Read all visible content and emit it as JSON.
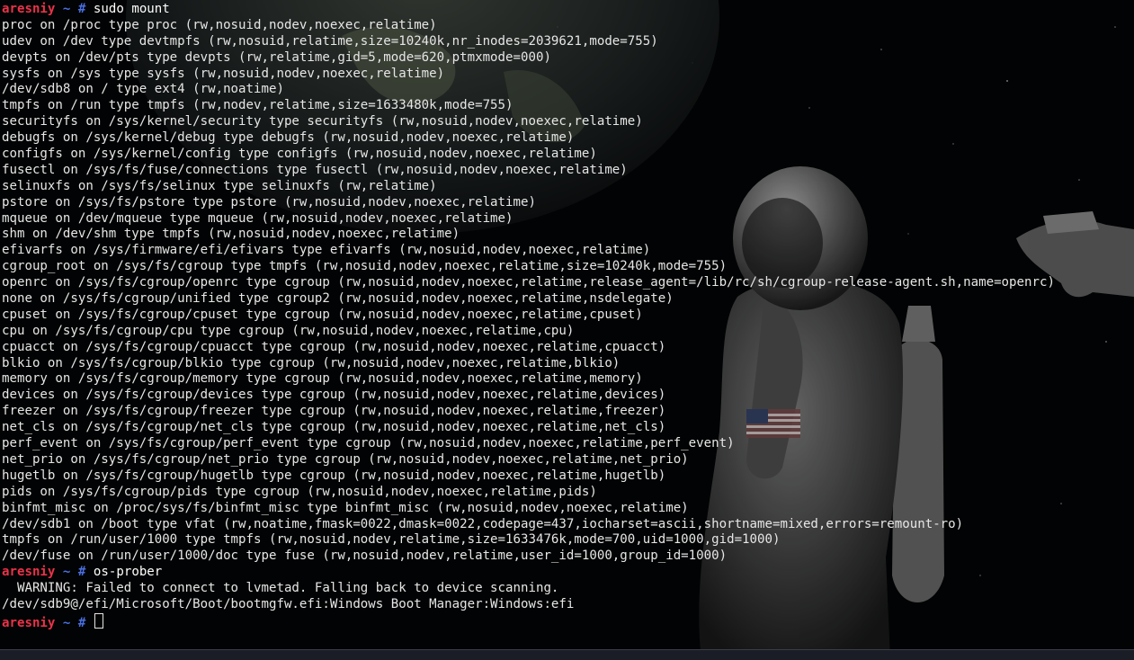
{
  "prompt": {
    "user": "aresniy",
    "dir": "~",
    "symbol": "#"
  },
  "session": [
    {
      "type": "prompt",
      "command": "sudo mount"
    },
    {
      "type": "output",
      "text": "proc on /proc type proc (rw,nosuid,nodev,noexec,relatime)"
    },
    {
      "type": "output",
      "text": "udev on /dev type devtmpfs (rw,nosuid,relatime,size=10240k,nr_inodes=2039621,mode=755)"
    },
    {
      "type": "output",
      "text": "devpts on /dev/pts type devpts (rw,relatime,gid=5,mode=620,ptmxmode=000)"
    },
    {
      "type": "output",
      "text": "sysfs on /sys type sysfs (rw,nosuid,nodev,noexec,relatime)"
    },
    {
      "type": "output",
      "text": "/dev/sdb8 on / type ext4 (rw,noatime)"
    },
    {
      "type": "output",
      "text": "tmpfs on /run type tmpfs (rw,nodev,relatime,size=1633480k,mode=755)"
    },
    {
      "type": "output",
      "text": "securityfs on /sys/kernel/security type securityfs (rw,nosuid,nodev,noexec,relatime)"
    },
    {
      "type": "output",
      "text": "debugfs on /sys/kernel/debug type debugfs (rw,nosuid,nodev,noexec,relatime)"
    },
    {
      "type": "output",
      "text": "configfs on /sys/kernel/config type configfs (rw,nosuid,nodev,noexec,relatime)"
    },
    {
      "type": "output",
      "text": "fusectl on /sys/fs/fuse/connections type fusectl (rw,nosuid,nodev,noexec,relatime)"
    },
    {
      "type": "output",
      "text": "selinuxfs on /sys/fs/selinux type selinuxfs (rw,relatime)"
    },
    {
      "type": "output",
      "text": "pstore on /sys/fs/pstore type pstore (rw,nosuid,nodev,noexec,relatime)"
    },
    {
      "type": "output",
      "text": "mqueue on /dev/mqueue type mqueue (rw,nosuid,nodev,noexec,relatime)"
    },
    {
      "type": "output",
      "text": "shm on /dev/shm type tmpfs (rw,nosuid,nodev,noexec,relatime)"
    },
    {
      "type": "output",
      "text": "efivarfs on /sys/firmware/efi/efivars type efivarfs (rw,nosuid,nodev,noexec,relatime)"
    },
    {
      "type": "output",
      "text": "cgroup_root on /sys/fs/cgroup type tmpfs (rw,nosuid,nodev,noexec,relatime,size=10240k,mode=755)"
    },
    {
      "type": "output",
      "text": "openrc on /sys/fs/cgroup/openrc type cgroup (rw,nosuid,nodev,noexec,relatime,release_agent=/lib/rc/sh/cgroup-release-agent.sh,name=openrc)"
    },
    {
      "type": "output",
      "text": "none on /sys/fs/cgroup/unified type cgroup2 (rw,nosuid,nodev,noexec,relatime,nsdelegate)"
    },
    {
      "type": "output",
      "text": "cpuset on /sys/fs/cgroup/cpuset type cgroup (rw,nosuid,nodev,noexec,relatime,cpuset)"
    },
    {
      "type": "output",
      "text": "cpu on /sys/fs/cgroup/cpu type cgroup (rw,nosuid,nodev,noexec,relatime,cpu)"
    },
    {
      "type": "output",
      "text": "cpuacct on /sys/fs/cgroup/cpuacct type cgroup (rw,nosuid,nodev,noexec,relatime,cpuacct)"
    },
    {
      "type": "output",
      "text": "blkio on /sys/fs/cgroup/blkio type cgroup (rw,nosuid,nodev,noexec,relatime,blkio)"
    },
    {
      "type": "output",
      "text": "memory on /sys/fs/cgroup/memory type cgroup (rw,nosuid,nodev,noexec,relatime,memory)"
    },
    {
      "type": "output",
      "text": "devices on /sys/fs/cgroup/devices type cgroup (rw,nosuid,nodev,noexec,relatime,devices)"
    },
    {
      "type": "output",
      "text": "freezer on /sys/fs/cgroup/freezer type cgroup (rw,nosuid,nodev,noexec,relatime,freezer)"
    },
    {
      "type": "output",
      "text": "net_cls on /sys/fs/cgroup/net_cls type cgroup (rw,nosuid,nodev,noexec,relatime,net_cls)"
    },
    {
      "type": "output",
      "text": "perf_event on /sys/fs/cgroup/perf_event type cgroup (rw,nosuid,nodev,noexec,relatime,perf_event)"
    },
    {
      "type": "output",
      "text": "net_prio on /sys/fs/cgroup/net_prio type cgroup (rw,nosuid,nodev,noexec,relatime,net_prio)"
    },
    {
      "type": "output",
      "text": "hugetlb on /sys/fs/cgroup/hugetlb type cgroup (rw,nosuid,nodev,noexec,relatime,hugetlb)"
    },
    {
      "type": "output",
      "text": "pids on /sys/fs/cgroup/pids type cgroup (rw,nosuid,nodev,noexec,relatime,pids)"
    },
    {
      "type": "output",
      "text": "binfmt_misc on /proc/sys/fs/binfmt_misc type binfmt_misc (rw,nosuid,nodev,noexec,relatime)"
    },
    {
      "type": "output",
      "text": "/dev/sdb1 on /boot type vfat (rw,noatime,fmask=0022,dmask=0022,codepage=437,iocharset=ascii,shortname=mixed,errors=remount-ro)"
    },
    {
      "type": "output",
      "text": "tmpfs on /run/user/1000 type tmpfs (rw,nosuid,nodev,relatime,size=1633476k,mode=700,uid=1000,gid=1000)"
    },
    {
      "type": "output",
      "text": "/dev/fuse on /run/user/1000/doc type fuse (rw,nosuid,nodev,relatime,user_id=1000,group_id=1000)"
    },
    {
      "type": "prompt",
      "command": "os-prober"
    },
    {
      "type": "output",
      "text": "  WARNING: Failed to connect to lvmetad. Falling back to device scanning."
    },
    {
      "type": "output",
      "text": "/dev/sdb9@/efi/Microsoft/Boot/bootmgfw.efi:Windows Boot Manager:Windows:efi"
    },
    {
      "type": "prompt",
      "command": "",
      "cursor": true
    }
  ],
  "colors": {
    "user": "#e8334a",
    "dir": "#4a6fe0",
    "text": "#e6e6e6",
    "background": "#000000"
  },
  "wallpaper_icons": [
    "earth-icon",
    "astronaut-icon",
    "flag-icon",
    "hand-pistol-icon"
  ]
}
